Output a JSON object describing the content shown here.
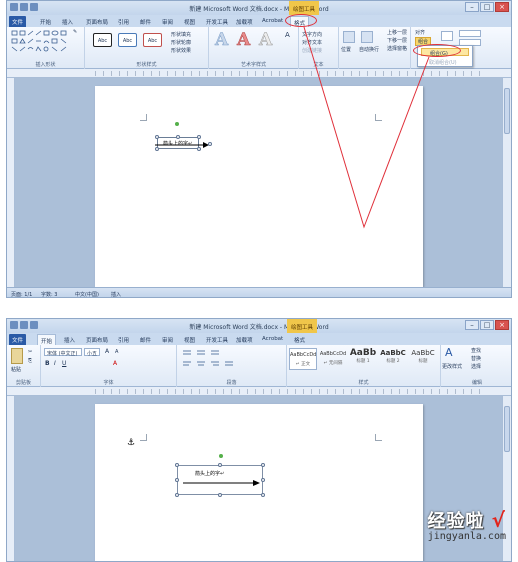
{
  "top": {
    "title": "新建 Microsoft Word 文档.docx - Microsoft Word",
    "context_tool": "绘图工具",
    "tabs": [
      "文件",
      "开始",
      "插入",
      "页面布局",
      "引用",
      "邮件",
      "审阅",
      "视图",
      "开发工具",
      "加载项",
      "Acrobat",
      "格式"
    ],
    "ribbon": {
      "insert_shapes_group": "插入形状",
      "edit_shape": "编辑形状",
      "text_box": "文本框",
      "styles_group": "形状样式",
      "style_swatch": "Abc",
      "shape_fill": "形状填充",
      "shape_outline": "形状轮廓",
      "shape_effect": "形状效果",
      "wordart_group": "艺术字样式",
      "wordart_letter": "A",
      "text_group": "文本",
      "text_direction": "文字方向",
      "align_text": "对齐文本",
      "create_link": "创建链接",
      "position": "位置",
      "wrap_text": "自动换行",
      "arrange_group": "排列",
      "bring_forward": "上移一层",
      "send_backward": "下移一层",
      "selection_pane": "选择窗格",
      "align": "对齐",
      "group": "组合",
      "group_menu": "组合(G)",
      "ungroup_menu": "取消组合(U)"
    },
    "textbox_text": "箭头上的字↵",
    "status": {
      "page": "页面: 1/1",
      "words": "字数: 3",
      "lang": "中文(中国)",
      "mode": "插入"
    }
  },
  "bottom": {
    "title": "新建 Microsoft Word 文档.docx - Microsoft Word",
    "context_tool": "绘图工具",
    "tabs": [
      "文件",
      "开始",
      "插入",
      "页面布局",
      "引用",
      "邮件",
      "审阅",
      "视图",
      "开发工具",
      "加载项",
      "Acrobat",
      "格式"
    ],
    "ribbon": {
      "clipboard_group": "剪贴板",
      "paste": "粘贴",
      "font_name": "宋体 (中文正)",
      "font_size": "小五",
      "font_group": "字体",
      "paragraph_group": "段落",
      "styles_group": "样式",
      "style_samples": [
        "AaBbCcDd",
        "AaBbCcDd",
        "AaBb",
        "AaBbC",
        "AaBbC"
      ],
      "style_names": [
        "↵ 正文",
        "↵ 无间隔",
        "标题 1",
        "标题 2",
        "标题"
      ],
      "change_styles": "更改样式",
      "editing_group": "编辑",
      "find": "查找",
      "replace": "替换",
      "select": "选择"
    },
    "textbox_text": "箭头上的字↵"
  },
  "watermark": {
    "cn": "经验啦",
    "url": "jingyanla.com"
  },
  "colors": {
    "annotation_red": "#e0303a",
    "file_tab": "#2a5aa6",
    "context_tab": "#f0c64a"
  }
}
